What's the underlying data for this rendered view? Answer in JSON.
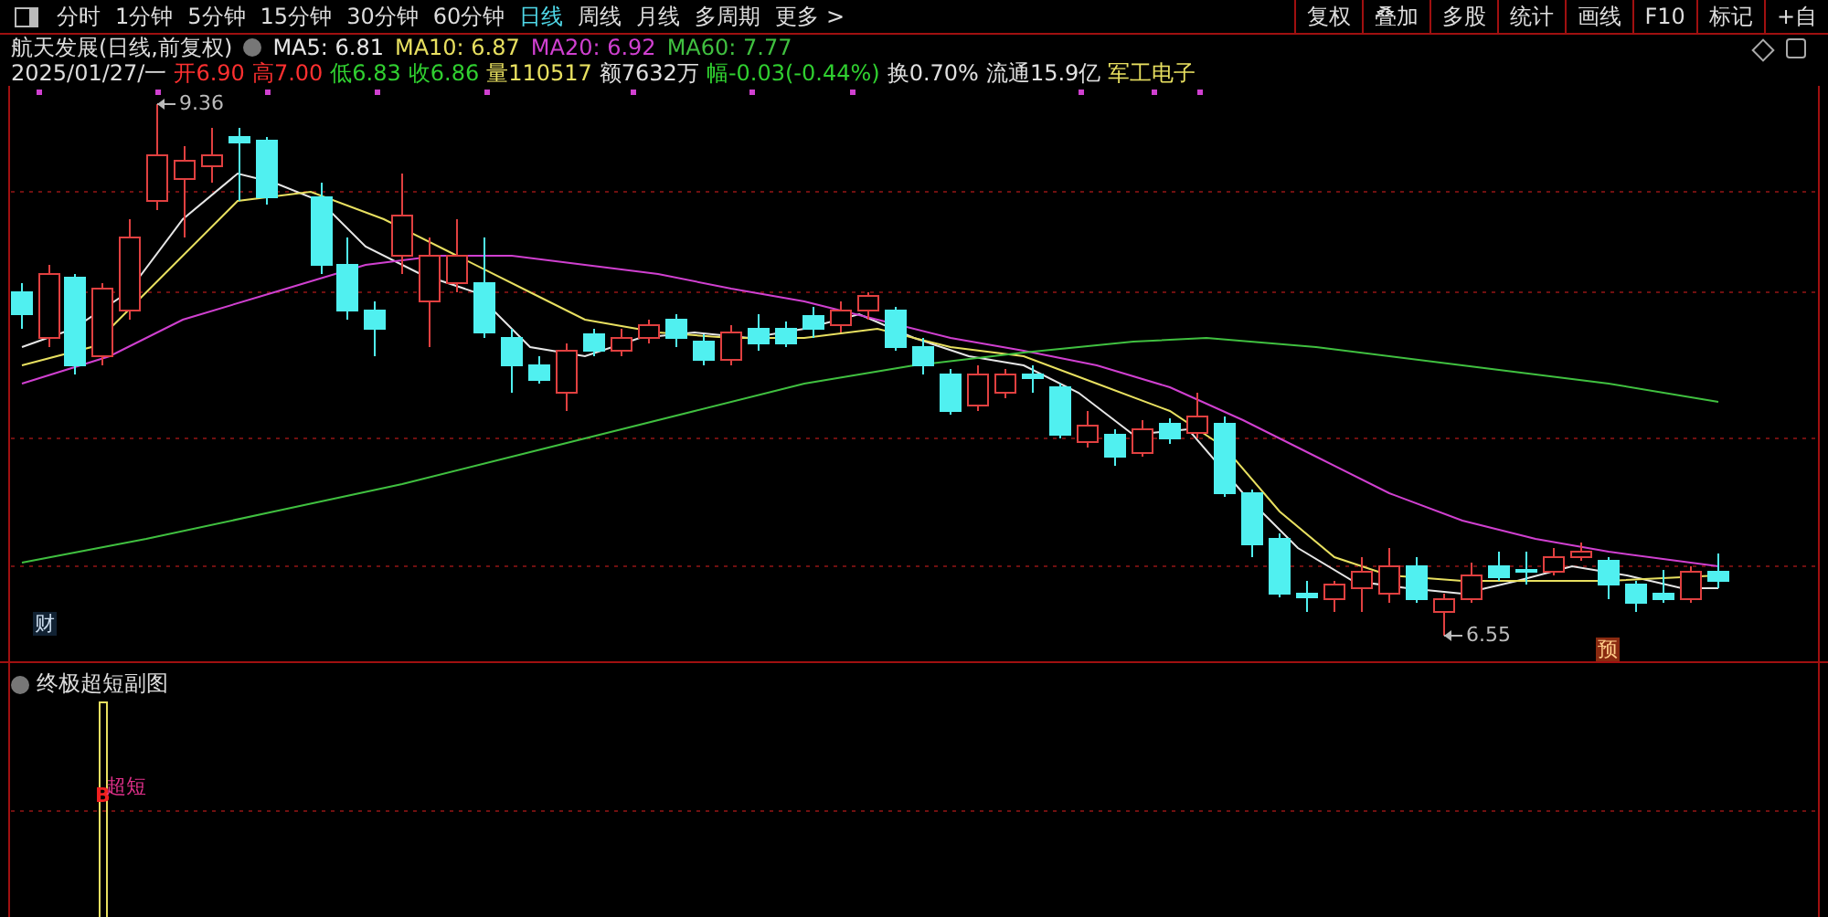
{
  "toolbar": {
    "periods": [
      {
        "label": "分时",
        "selected": false
      },
      {
        "label": "1分钟",
        "selected": false
      },
      {
        "label": "5分钟",
        "selected": false
      },
      {
        "label": "15分钟",
        "selected": false
      },
      {
        "label": "30分钟",
        "selected": false
      },
      {
        "label": "60分钟",
        "selected": false
      },
      {
        "label": "日线",
        "selected": true
      },
      {
        "label": "周线",
        "selected": false
      },
      {
        "label": "月线",
        "selected": false
      },
      {
        "label": "多周期",
        "selected": false
      },
      {
        "label": "更多 >",
        "selected": false
      }
    ],
    "tools": [
      "复权",
      "叠加",
      "多股",
      "统计",
      "画线",
      "F10",
      "标记",
      "+自"
    ]
  },
  "stock": {
    "title": "航天发展(日线,前复权)",
    "moving_averages": [
      {
        "label": "MA5: 6.81",
        "color": "#e6e6e6"
      },
      {
        "label": "MA10: 6.87",
        "color": "#e8e060"
      },
      {
        "label": "MA20: 6.92",
        "color": "#d040d0"
      },
      {
        "label": "MA60: 7.77",
        "color": "#40c040"
      }
    ],
    "date": "2025/01/27/一",
    "quote": [
      {
        "label": "开6.90",
        "color": "#ff3030"
      },
      {
        "label": "高7.00",
        "color": "#ff3030"
      },
      {
        "label": "低6.83",
        "color": "#30d030"
      },
      {
        "label": "收6.86",
        "color": "#30d030"
      },
      {
        "label": "量110517",
        "color": "#e8e060"
      },
      {
        "label": "额7632万",
        "color": "#e0e0e0"
      },
      {
        "label": "幅-0.03(-0.44%)",
        "color": "#30d030"
      },
      {
        "label": "换0.70%",
        "color": "#e0e0e0"
      },
      {
        "label": "流通15.9亿",
        "color": "#e0e0e0"
      },
      {
        "label": "军工电子",
        "color": "#e8e060"
      }
    ]
  },
  "main_chart": {
    "high_label": "9.36",
    "low_label": "6.55",
    "finance_badge": "财",
    "forecast_badge": "预"
  },
  "sub_chart": {
    "title": "终极超短副图",
    "signal": "B",
    "signal_label": "超短"
  }
}
